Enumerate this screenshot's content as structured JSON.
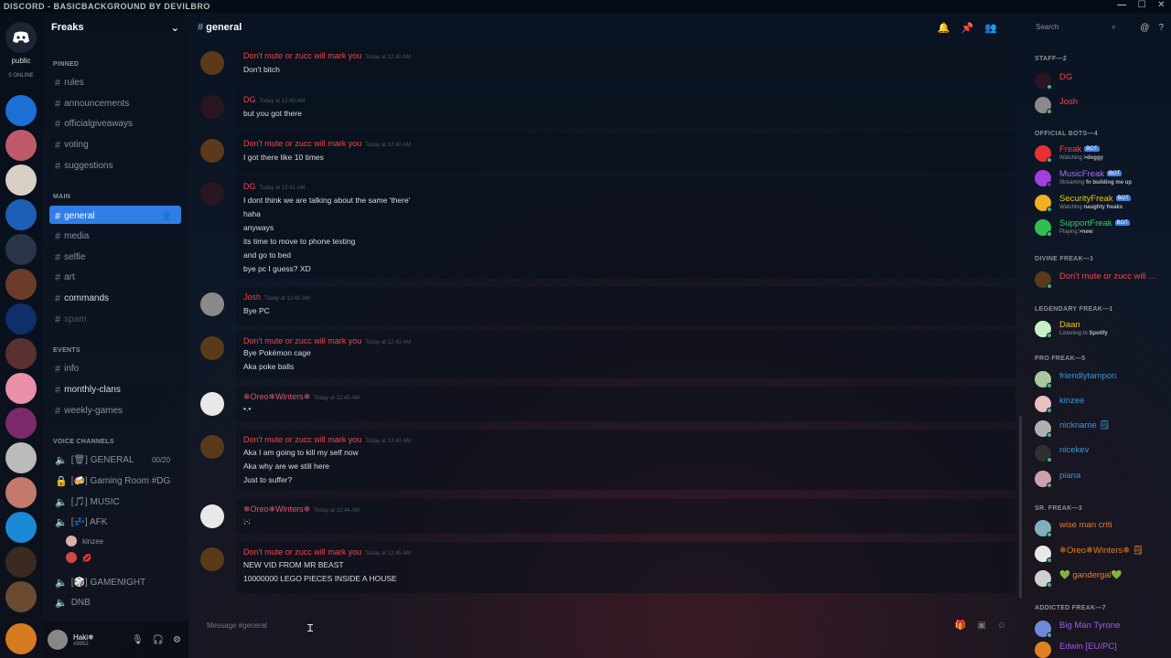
{
  "window": {
    "title": "DISCORD - BASICBACKGROUND BY DEVILBRO",
    "controls": [
      "—",
      "☐",
      "✕"
    ]
  },
  "rail": {
    "home_label": "public",
    "online_label": "0 ONLINE"
  },
  "guild": {
    "name": "Freaks"
  },
  "channels": {
    "pinned_label": "PINNED",
    "main_label": "MAIN",
    "events_label": "EVENTS",
    "voice_label": "VOICE CHANNELS",
    "rules": "rules",
    "announcements": "announcements",
    "officialgiveaways": "officialgiveaways",
    "voting": "voting",
    "suggestions": "suggestions",
    "general": "general",
    "media": "media",
    "selfie": "selfie",
    "art": "art",
    "commands": "commands",
    "spam": "spam",
    "info": "info",
    "monthly_clans": "monthly-clans",
    "weekly_games": "weekly-games",
    "v_general": "[🗑] GENERAL",
    "v_general_count": "00/20",
    "v_gaming": "[🍻] Gaming Room #DG",
    "v_music": "[🎵] MUSIC",
    "v_afk": "[💤] AFK",
    "v_user1": "kinzee",
    "v_user2": "💋",
    "v_gamenight": "[🎲] GAMENIGHT",
    "dnb": "DNB"
  },
  "user_panel": {
    "name": "Haki❄",
    "tag": "#8952"
  },
  "topbar": {
    "channel": "general",
    "search_placeholder": "Search"
  },
  "messages": [
    {
      "author": "Don't mute or zucc will mark you",
      "ts": "Today at 12:40 AM",
      "lines": [
        "Don't bitch"
      ]
    },
    {
      "author": "DG",
      "ts": "Today at 12:40 AM",
      "lines": [
        "but you got there"
      ]
    },
    {
      "author": "Don't mute or zucc will mark you",
      "ts": "Today at 12:40 AM",
      "lines": [
        "I got there like 10 times"
      ]
    },
    {
      "author": "DG",
      "ts": "Today at 12:41 AM",
      "lines": [
        "I dont think we are talking about the same 'there'",
        "haha",
        "anyways",
        "its time to move to phone texting",
        "and go to bed",
        "bye pc I guess? XD"
      ]
    },
    {
      "author": "Josh",
      "ts": "Today at 12:42 AM",
      "lines": [
        "Bye PC"
      ]
    },
    {
      "author": "Don't mute or zucc will mark you",
      "ts": "Today at 12:43 AM",
      "lines": [
        "Bye Pokémon cage",
        "Aka poke balls"
      ]
    },
    {
      "author": "❄Oreo❄Winters❄",
      "ts": "Today at 12:43 AM",
      "lines": [
        "•.•"
      ]
    },
    {
      "author": "Don't mute or zucc will mark you",
      "ts": "Today at 12:43 AM",
      "lines": [
        "Aka I am going to kill my self now",
        "Aka why are we still here",
        "Just to suffer?"
      ]
    },
    {
      "author": "❄Oreo❄Winters❄",
      "ts": "Today at 12:44 AM",
      "lines": [
        ";-;"
      ]
    },
    {
      "author": "Don't mute or zucc will mark you",
      "ts": "Today at 12:45 AM",
      "lines": [
        "NEW VID FROM MR BEAST",
        "10000000 LEGO PIECES INSIDE A HOUSE"
      ]
    }
  ],
  "composer": {
    "placeholder": "Message #general"
  },
  "members": {
    "staff_label": "STAFF—2",
    "bots_label": "OFFICIAL BOTS—4",
    "divine_label": "DIVINE FREAK—1",
    "legendary_label": "LEGENDARY FREAK—1",
    "pro_label": "PRO FREAK—5",
    "sr_label": "SR. FREAK—3",
    "addicted_label": "ADDICTED FREAK—7",
    "bot_tag": "BOT",
    "staff": [
      "DG",
      "Josh"
    ],
    "bots": [
      {
        "name": "Freak",
        "status_prefix": "Watching",
        "status": ">doggy"
      },
      {
        "name": "MusicFreak",
        "status_prefix": "Streaming",
        "status": "fn building me up"
      },
      {
        "name": "SecurityFreak",
        "status_prefix": "Watching",
        "status": "naughty freaks"
      },
      {
        "name": "SupportFreak",
        "status_prefix": "Playing",
        "status": ">new"
      }
    ],
    "divine": "Don't mute or zucc will ...",
    "legendary": {
      "name": "Daan",
      "status_prefix": "Listening to",
      "status": "Spotify"
    },
    "pro": [
      "friendlytampon",
      "kinzee",
      "nickname 🗒",
      "nicekev",
      "piana"
    ],
    "sr": [
      "wise man criti",
      "❄Oreo❄Winters❄ 🗒",
      "💚 gandergal💚"
    ],
    "addicted": [
      "Big Man Tyrone",
      "Edwin [EU/PC]"
    ]
  },
  "colors": {
    "accent": "#2f7ee8",
    "author_red": "#f04747",
    "bot_blue": "#3e82e5",
    "online": "#43b581"
  }
}
